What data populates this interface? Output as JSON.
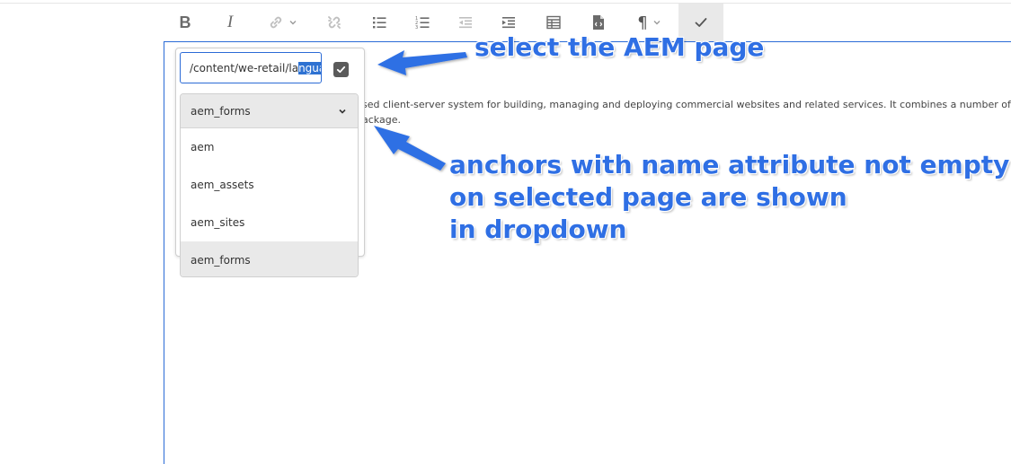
{
  "toolbar": {
    "buttons": [
      {
        "name": "bold",
        "label": "B"
      },
      {
        "name": "italic",
        "label": "I"
      },
      {
        "name": "link",
        "label": ""
      },
      {
        "name": "unlink",
        "label": ""
      },
      {
        "name": "bulleted-list",
        "label": ""
      },
      {
        "name": "numbered-list",
        "label": ""
      },
      {
        "name": "outdent",
        "label": ""
      },
      {
        "name": "indent",
        "label": ""
      },
      {
        "name": "table",
        "label": ""
      },
      {
        "name": "source-edit",
        "label": ""
      },
      {
        "name": "paragraph-format",
        "label": "¶"
      },
      {
        "name": "done",
        "label": ""
      }
    ]
  },
  "editor": {
    "line1": "sed client-server system for building, managing and deploying commercial websites and related services. It combines a number of infrastru",
    "line2": "ackage."
  },
  "link_dialog": {
    "path_value_plain": "/content/we-retail/la",
    "path_value_selected": "nguag",
    "confirm_icon": "checkbox-check-icon"
  },
  "anchor_dropdown": {
    "selected": "aem_forms",
    "options": [
      "aem",
      "aem_assets",
      "aem_sites",
      "aem_forms"
    ]
  },
  "annotations": {
    "page_hint": "select the AEM page",
    "anchor_hint_lines": [
      "anchors with name attribute not empty",
      "on selected page are shown",
      "in dropdown"
    ]
  },
  "colors": {
    "accent": "#2b6bd6",
    "annotation": "#2f6fe4",
    "selection": "#2e72d2"
  }
}
